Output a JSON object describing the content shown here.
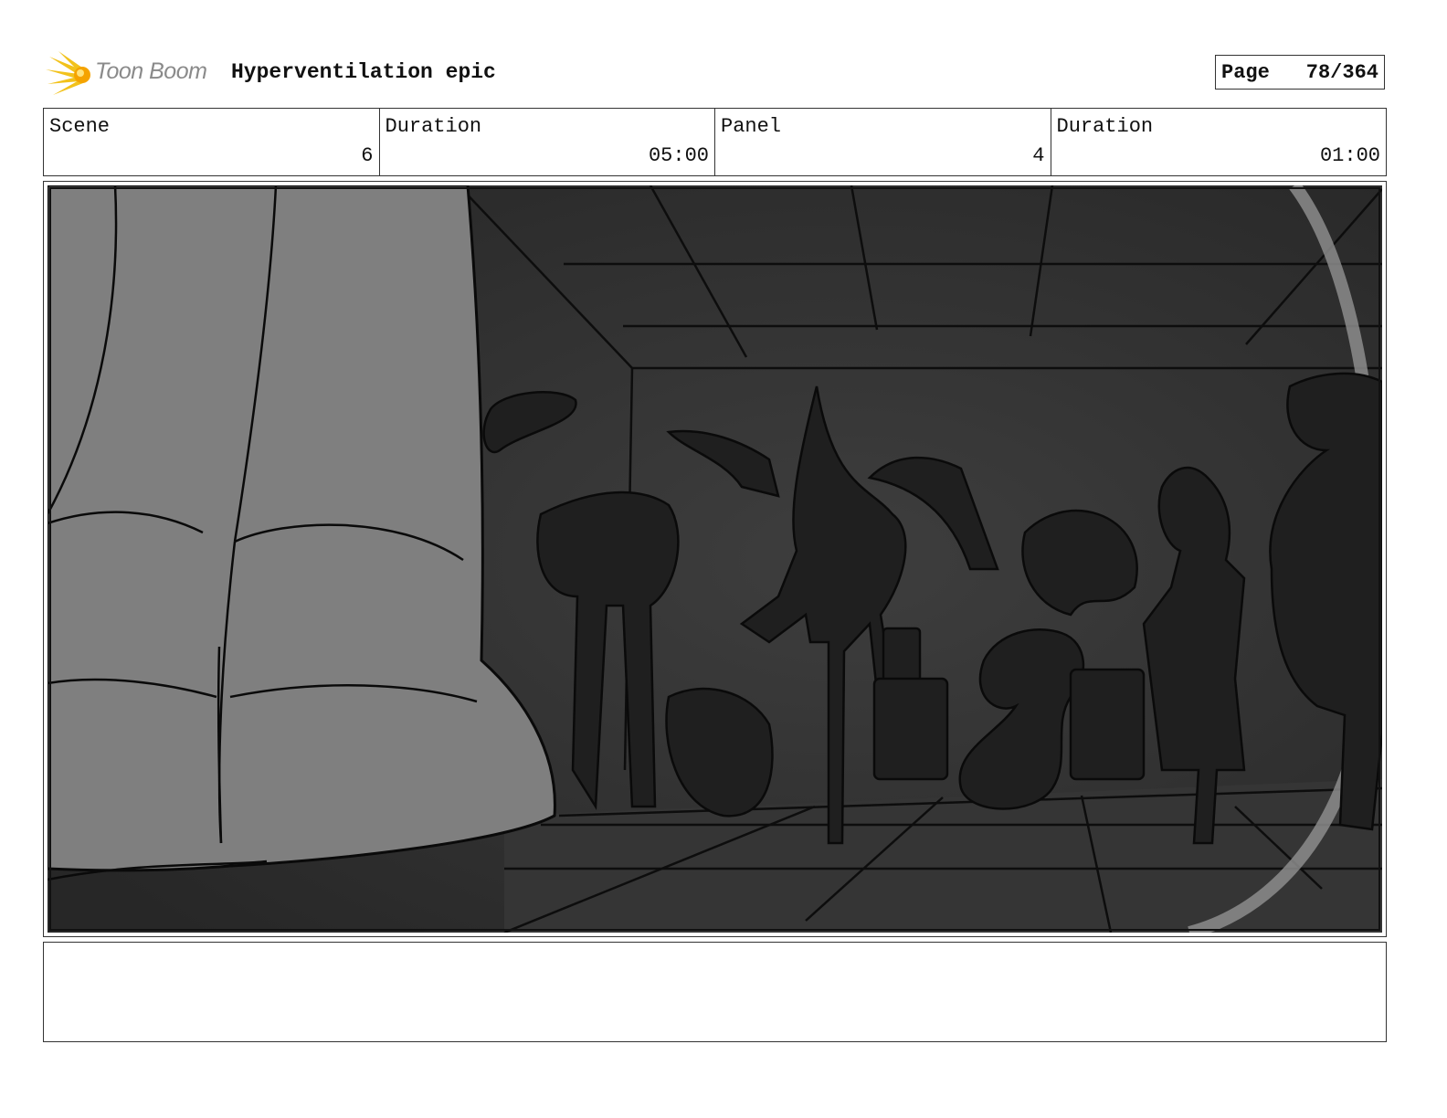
{
  "header": {
    "logo_text": "Toon Boom",
    "project_title": "Hyperventilation epic",
    "page_label": "Page",
    "page_number": "78/364"
  },
  "info": {
    "scene_label": "Scene",
    "scene_value": "6",
    "scene_duration_label": "Duration",
    "scene_duration_value": "05:00",
    "panel_label": "Panel",
    "panel_value": "4",
    "panel_duration_label": "Duration",
    "panel_duration_value": "01:00"
  },
  "notes": {
    "text": ""
  }
}
